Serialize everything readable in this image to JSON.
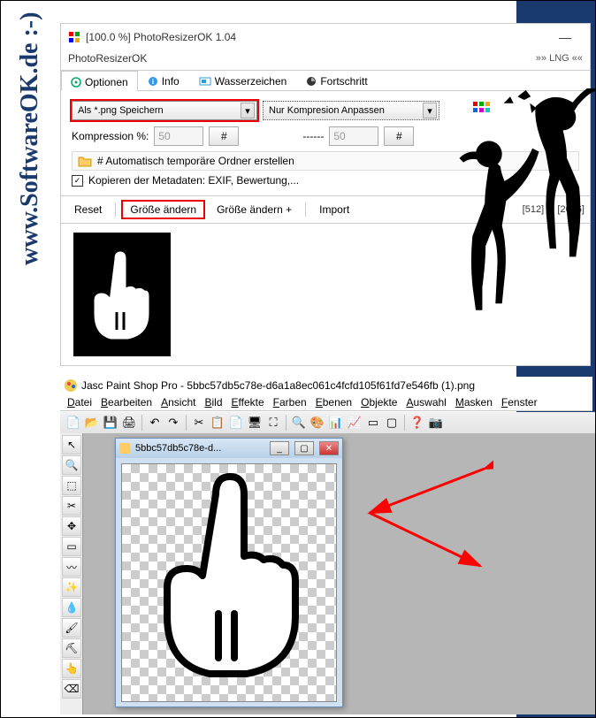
{
  "watermark": "www.SoftwareOK.de :-)",
  "app": {
    "title": "[100.0 %] PhotoResizerOK 1.04",
    "menu_name": "PhotoResizerOK",
    "lng": "»» LNG ««",
    "tabs": {
      "optionen": "Optionen",
      "info": "Info",
      "wasserzeichen": "Wasserzeichen",
      "fortschritt": "Fortschritt"
    },
    "save_as": "Als *.png Speichern",
    "compression_mode": "Nur Kompresion Anpassen",
    "compression_label": "Kompression %:",
    "compression_value": "50",
    "dashes": "------",
    "right_value": "50",
    "hash": "#",
    "folder_line": "# Automatisch temporäre Ordner erstellen",
    "metadata_line": "Kopieren der Metadaten: EXIF, Bewertung,...",
    "buttons": {
      "reset": "Reset",
      "resize": "Größe ändern",
      "resize_plus": "Größe ändern +",
      "import": "Import"
    },
    "dims": "[512] ... [2056]"
  },
  "psp": {
    "title": "Jasc Paint Shop Pro - 5bbc57db5c78e-d6a1a8ec061c4fcfd105f61fd7e546fb (1).png",
    "menu": {
      "datei": "Datei",
      "bearbeiten": "Bearbeiten",
      "ansicht": "Ansicht",
      "bild": "Bild",
      "effekte": "Effekte",
      "farben": "Farben",
      "ebenen": "Ebenen",
      "objekte": "Objekte",
      "auswahl": "Auswahl",
      "masken": "Masken",
      "fenster": "Fenster"
    },
    "doc_title": "5bbc57db5c78e-d..."
  }
}
